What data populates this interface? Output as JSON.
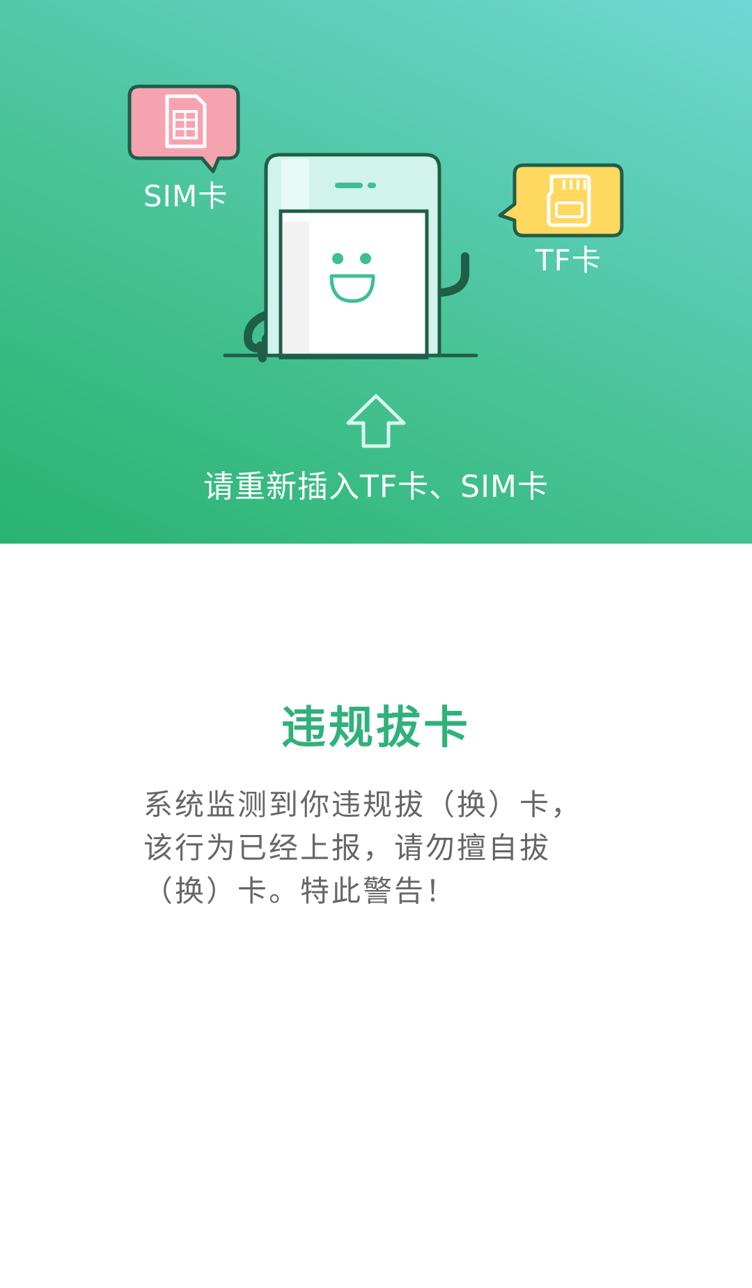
{
  "hero": {
    "sim_label": "SIM卡",
    "tf_label": "TF卡",
    "hint": "请重新插入TF卡、SIM卡",
    "icons": [
      "sim-card-icon",
      "tf-card-icon",
      "phone-mascot-icon",
      "up-arrow-icon"
    ]
  },
  "notice": {
    "title": "违规拔卡",
    "message": "系统监测到你违规拔（换）卡，该行为已经上报，请勿擅自拔（换）卡。特此警告！"
  },
  "colors": {
    "gradient_start": "#29b36f",
    "gradient_end": "#6fd8d5",
    "title": "#2fb17a",
    "body_text": "#666666",
    "sim_bubble": "#f6a3b1",
    "tf_bubble": "#ffd85f",
    "outline": "#1f5e47"
  }
}
